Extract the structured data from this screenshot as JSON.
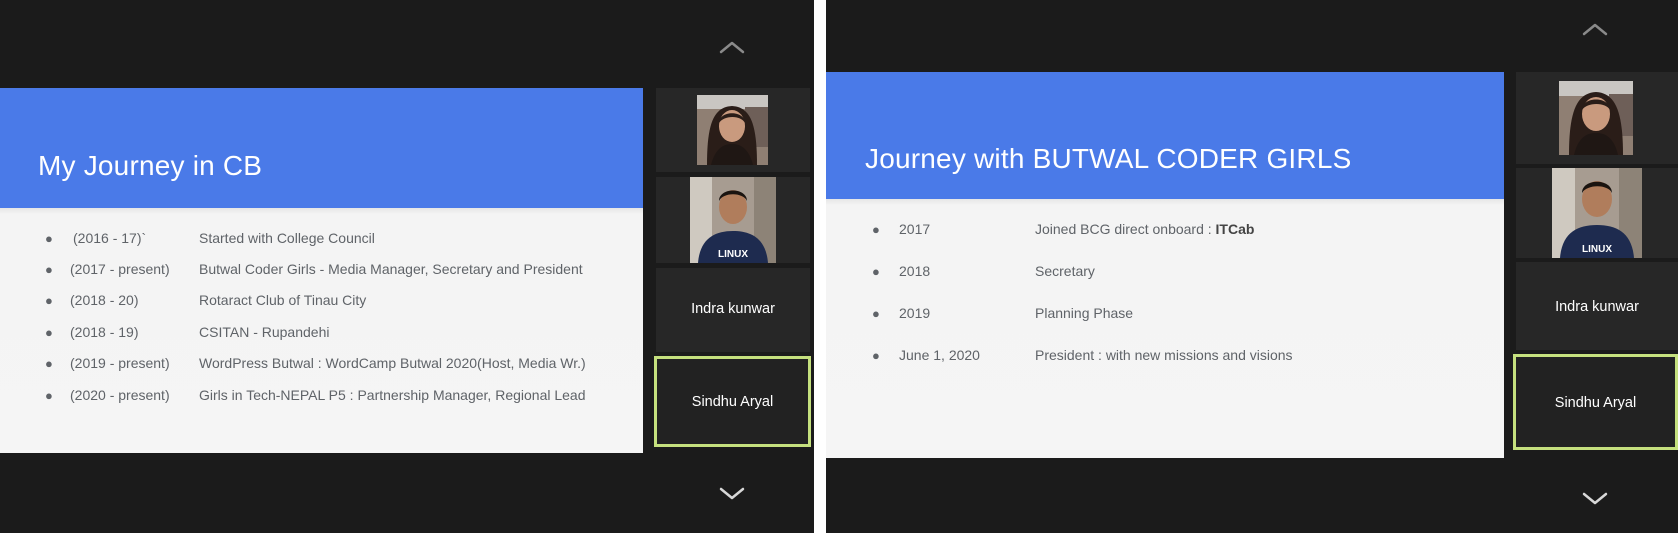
{
  "left": {
    "slide": {
      "title": "My Journey in CB",
      "items": [
        {
          "year": "(2016 - 17)`",
          "text": "Started with College Council"
        },
        {
          "year": "(2017 - present)",
          "text": "Butwal Coder Girls - Media Manager, Secretary and President"
        },
        {
          "year": "(2018 - 20)",
          "text": "Rotaract Club of Tinau City"
        },
        {
          "year": "(2018 - 19)",
          "text": "CSITAN - Rupandehi"
        },
        {
          "year": "(2019 - present)",
          "text": "WordPress Butwal : WordCamp Butwal 2020(Host, Media Wr.)"
        },
        {
          "year": "(2020 - present)",
          "text": "Girls in Tech-NEPAL P5 : Partnership Manager, Regional Lead"
        }
      ]
    },
    "participants": {
      "tile3_name": "Indra kunwar",
      "tile4_name": "Sindhu Aryal",
      "shirt_text": "LINUX"
    }
  },
  "right": {
    "slide": {
      "title": "Journey with BUTWAL CODER GIRLS",
      "items": [
        {
          "year": "2017",
          "text": "Joined BCG direct onboard  :",
          "bold": "ITCab"
        },
        {
          "year": "2018",
          "text": "Secretary",
          "bold": ""
        },
        {
          "year": "2019",
          "text": "Planning Phase",
          "bold": ""
        },
        {
          "year": "June 1, 2020",
          "text": "President : with new missions and visions",
          "bold": ""
        }
      ]
    },
    "participants": {
      "tile3_name": "Indra kunwar",
      "tile4_name": "Sindhu Aryal",
      "shirt_text": "LINUX"
    }
  },
  "bullet": "●",
  "icons": {
    "scroll_up": "chevron-up-icon",
    "scroll_down": "chevron-down-icon"
  },
  "colors": {
    "background": "#1b1b1b",
    "slide_banner": "#4a7ae8",
    "slide_body": "#f5f5f5",
    "tile": "#272727",
    "active_speaker_border": "#c5e07e",
    "text_gray": "#5f6368"
  }
}
